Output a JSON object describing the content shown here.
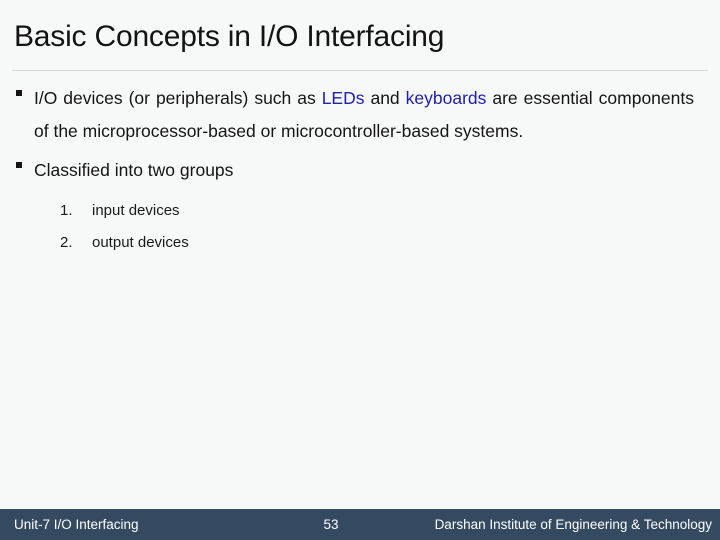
{
  "slide": {
    "title": "Basic Concepts in I/O Interfacing",
    "background_color": "#f7f8f8",
    "rule_color": "#d3d6d8"
  },
  "body": {
    "bullet_glyph": "square-bullet",
    "bullets": [
      {
        "id": "io-devices",
        "segments": [
          {
            "text": "I/O devices (or peripherals) such as ",
            "style": "normal"
          },
          {
            "text": "LEDs",
            "style": "highlight"
          },
          {
            "text": " and ",
            "style": "normal"
          },
          {
            "text": "keyboards",
            "style": "highlight"
          },
          {
            "text": " are essential components of the microprocessor-based or microcontroller-based systems.",
            "style": "normal"
          }
        ]
      },
      {
        "id": "classified",
        "segments": [
          {
            "text": "Classified into two groups",
            "style": "normal"
          }
        ]
      }
    ],
    "numbered_list": [
      {
        "index": "1.",
        "label": "input devices"
      },
      {
        "index": "2.",
        "label": "output devices"
      }
    ],
    "highlight_color": "#2020a8",
    "text_color": "#151515"
  },
  "footer": {
    "left_label": "Unit-7 I/O Interfacing",
    "page_number": "53",
    "right_label": "Darshan Institute of Engineering & Technology",
    "background_color": "#344a61",
    "text_color": "#ffffff"
  }
}
